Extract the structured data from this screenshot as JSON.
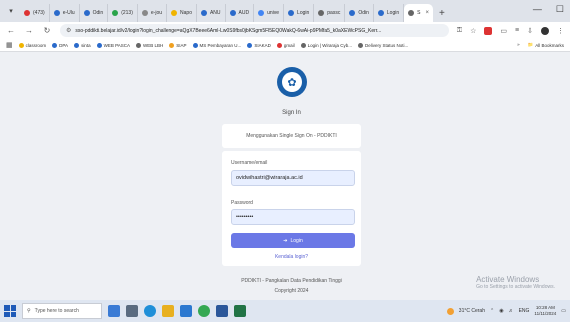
{
  "browser": {
    "tabs": [
      {
        "label": "(473)",
        "color": "#d33"
      },
      {
        "label": "e-Ulu",
        "color": "#2a6acb"
      },
      {
        "label": "Odin",
        "color": "#2a6acb"
      },
      {
        "label": "(213)",
        "color": "#29a34a"
      },
      {
        "label": "e-jou",
        "color": "#888"
      },
      {
        "label": "Napo",
        "color": "#f0b400"
      },
      {
        "label": "ANU",
        "color": "#2a6acb"
      },
      {
        "label": "AUD",
        "color": "#2a6acb"
      },
      {
        "label": "unive",
        "color": "#4285f4"
      },
      {
        "label": "Login",
        "color": "#2a6acb"
      },
      {
        "label": "passc",
        "color": "#666"
      },
      {
        "label": "Odin",
        "color": "#2a6acb"
      },
      {
        "label": "Login",
        "color": "#2a6acb"
      },
      {
        "label": "S",
        "color": "#666"
      }
    ],
    "new_tab_icon": "+",
    "window_controls": [
      "—",
      "☐"
    ],
    "url": "sso-pddikti.belajar.id/v2/login?login_challenge=aQgX7Beee6Aml-Lw0S9fbs0jbKSgm5Fl5EQ0WakQ-6wAi-p9PMfa5_k0aXEWcPSG_Kerr...",
    "bookmarks": [
      {
        "label": "classroom",
        "color": "#f0b400"
      },
      {
        "label": "DPA",
        "color": "#2a6acb"
      },
      {
        "label": "sinta",
        "color": "#2a6acb"
      },
      {
        "label": "WEB PASCA",
        "color": "#2a6acb"
      },
      {
        "label": "WEB LBH",
        "color": "#666"
      },
      {
        "label": "SIAP",
        "color": "#f0a020"
      },
      {
        "label": "MS Pembayaran U...",
        "color": "#2a6acb"
      },
      {
        "label": "SIAKAD",
        "color": "#2a6acb"
      },
      {
        "label": "gmail",
        "color": "#d33"
      },
      {
        "label": "Login | Wiraraja Cyb...",
        "color": "#666"
      },
      {
        "label": "Delivery Status Noti...",
        "color": "#666"
      }
    ],
    "all_bookmarks": "All Bookmarks"
  },
  "page": {
    "title": "Sign In",
    "sso_text": "Menggunakan Single Sign On - PDDIKTI",
    "username_label": "Username/email",
    "username_value": "ovidwihastri@wiraraja.ac.id",
    "password_label": "Password",
    "password_value": "•••••••••",
    "login_label": "Login",
    "forgot_label": "Kendala login?",
    "footer_line1": "PDDIKTI - Pangkalan Data Pendidikan Tinggi",
    "footer_line2": "Copyright 2024",
    "activate_title": "Activate Windows",
    "activate_sub": "Go to Settings to activate Windows."
  },
  "taskbar": {
    "search_placeholder": "Type here to search",
    "weather": "31°C Cerah",
    "lang": "ENG",
    "time": "10:28 AM",
    "date": "11/11/2024"
  }
}
